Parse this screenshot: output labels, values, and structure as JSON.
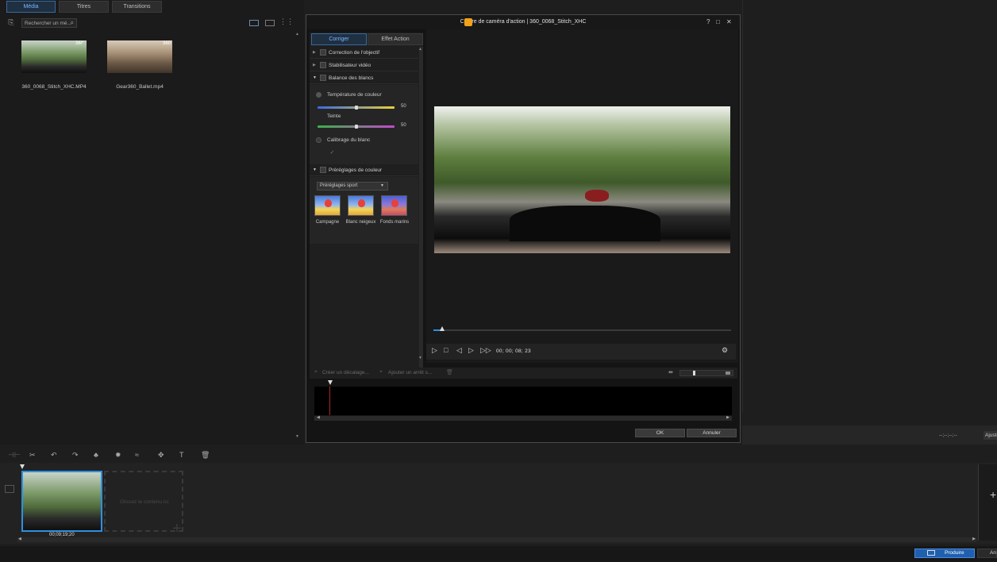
{
  "media": {
    "tabs": [
      "Média",
      "Titres",
      "Transitions"
    ],
    "search_placeholder": "Rechercher un mé...",
    "items": [
      {
        "name": "360_0068_Stitch_XHC.MP4",
        "badge": "360"
      },
      {
        "name": "Gear360_Ballet.mp4",
        "badge": "360"
      }
    ]
  },
  "dialog": {
    "title": "Centre de caméra d'action  |  360_0068_Stitch_XHC",
    "tabs": [
      "Corriger",
      "Effet Action"
    ],
    "sections": {
      "lens": "Correction de l'objectif",
      "stabilizer": "Stabilisateur vidéo",
      "white_balance": "Balance des blancs",
      "color_presets": "Préréglages de couleur"
    },
    "wb": {
      "temp_label": "Température de couleur",
      "temp_value": "50",
      "tint_label": "Teinte",
      "tint_value": "50",
      "calib_label": "Calibrage du blanc",
      "temp_level": 0.5,
      "tint_level": 0.5
    },
    "presets": {
      "dropdown": "Préréglages sport",
      "items": [
        "Campagne",
        "Blanc neigeux",
        "Fonds marins"
      ]
    },
    "timecode": "00; 00; 08; 23",
    "playhead_level": 0.03,
    "bottom_toolbar": {
      "create_offset": "Créer un décalage...",
      "add_stop": "Ajouter un arrêt s..."
    },
    "ok": "OK",
    "cancel": "Annuler"
  },
  "right_panel": {
    "timecode": "--;--;--;--",
    "adjust_label": "Ajuste"
  },
  "timeline": {
    "clip_time": "00;09;19;20",
    "drop_hint": "Glissez le contenu ici"
  },
  "bottom": {
    "produce": "Produire",
    "other": "An"
  },
  "colors": {
    "accent": "#2f8fe0",
    "clip_border": "#2f8fe0",
    "produce_bg": "#1f5fb0"
  }
}
